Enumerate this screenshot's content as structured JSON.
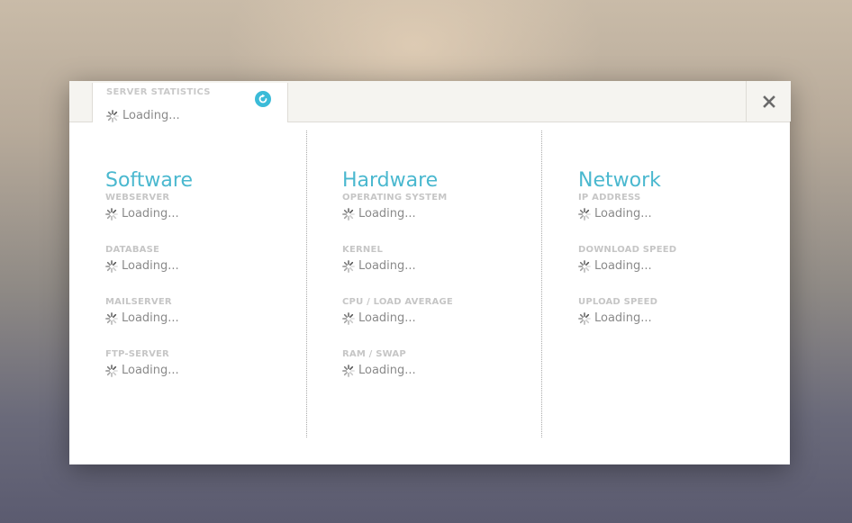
{
  "tab": {
    "title": "SERVER STATISTICS",
    "status": "Loading..."
  },
  "colors": {
    "accent": "#4ab8cf",
    "label": "#c6c6c6",
    "text": "#8a8a8a"
  },
  "icons": {
    "refresh": "refresh-icon",
    "close": "close-icon",
    "spinner": "spinner-icon"
  },
  "software": {
    "title": "Software",
    "items": [
      {
        "label": "WEBSERVER",
        "value": "Loading..."
      },
      {
        "label": "DATABASE",
        "value": "Loading..."
      },
      {
        "label": "MAILSERVER",
        "value": "Loading..."
      },
      {
        "label": "FTP-SERVER",
        "value": "Loading..."
      }
    ]
  },
  "hardware": {
    "title": "Hardware",
    "items": [
      {
        "label": "OPERATING SYSTEM",
        "value": "Loading..."
      },
      {
        "label": "KERNEL",
        "value": "Loading..."
      },
      {
        "label": "CPU / LOAD AVERAGE",
        "value": "Loading..."
      },
      {
        "label": "RAM / SWAP",
        "value": "Loading..."
      }
    ]
  },
  "network": {
    "title": "Network",
    "items": [
      {
        "label": "IP ADDRESS",
        "value": "Loading..."
      },
      {
        "label": "DOWNLOAD SPEED",
        "value": "Loading..."
      },
      {
        "label": "UPLOAD SPEED",
        "value": "Loading..."
      }
    ]
  }
}
